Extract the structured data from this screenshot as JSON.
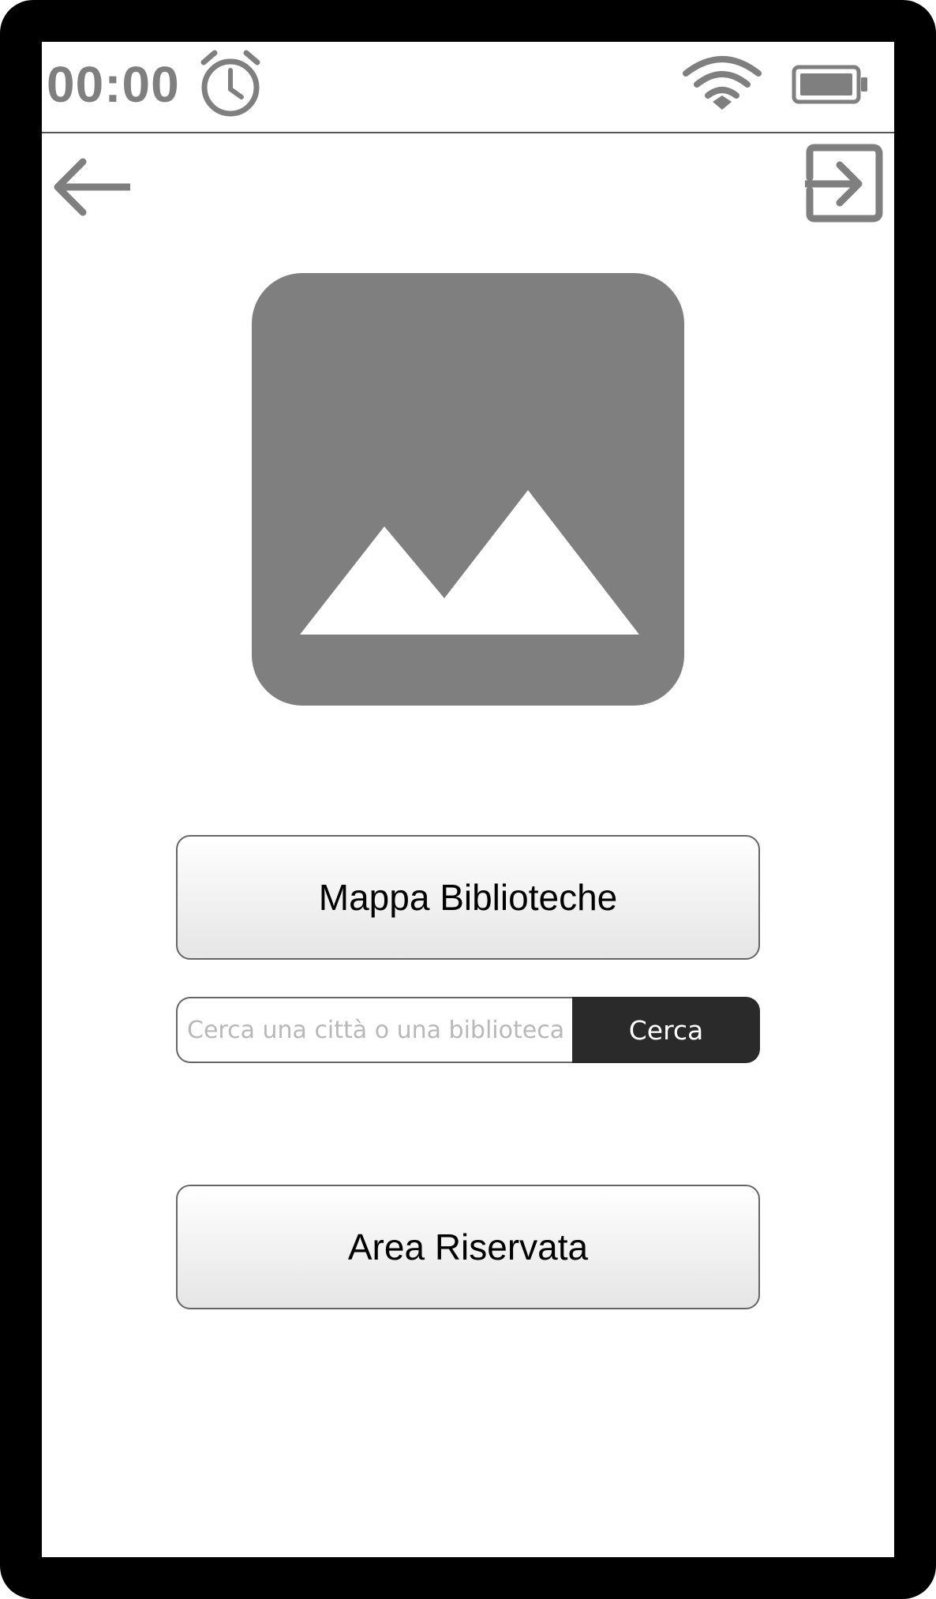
{
  "status_bar": {
    "time": "00:00",
    "icons": [
      "alarm-icon",
      "wifi-icon",
      "battery-icon"
    ]
  },
  "nav": {
    "back_icon": "back-arrow-icon",
    "logout_icon": "logout-icon"
  },
  "hero": {
    "icon": "image-placeholder-icon"
  },
  "main": {
    "map_button_label": "Mappa Biblioteche",
    "search": {
      "placeholder": "Cerca una città o una biblioteca",
      "value": "",
      "button_label": "Cerca"
    },
    "reserved_button_label": "Area Riservata"
  },
  "colors": {
    "frame": "#000000",
    "icon_gray": "#7f7f7f",
    "search_button": "#2a2a2a"
  }
}
